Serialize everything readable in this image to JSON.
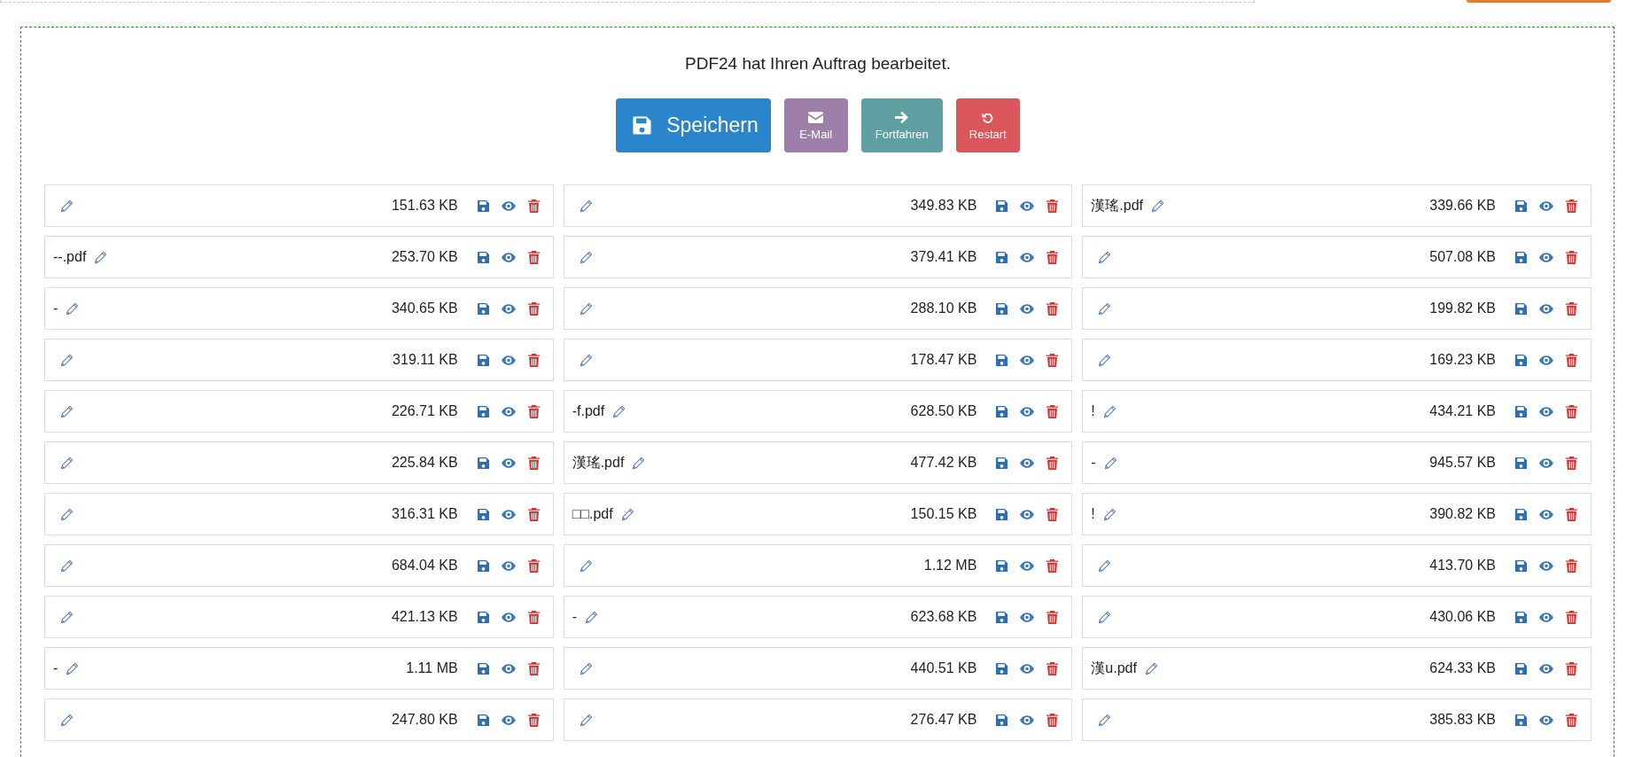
{
  "message": "PDF24 hat Ihren Auftrag bearbeitet.",
  "actions": [
    {
      "kind": "save",
      "label": "Speichern"
    },
    {
      "kind": "email",
      "label": "E-Mail"
    },
    {
      "kind": "continue",
      "label": "Fortfahren"
    },
    {
      "kind": "restart",
      "label": "Restart"
    }
  ],
  "files": [
    {
      "size": "151.63 KB"
    },
    {
      "size": "349.83 KB"
    },
    {
      "name": "漢瑤.pdf",
      "size": "339.66 KB"
    },
    {
      "name": "--.pdf",
      "size": "253.70 KB"
    },
    {
      "size": "379.41 KB"
    },
    {
      "size": "507.08 KB"
    },
    {
      "name": "-",
      "size": "340.65 KB"
    },
    {
      "size": "288.10 KB"
    },
    {
      "size": "199.82 KB"
    },
    {
      "size": "319.11 KB"
    },
    {
      "size": "178.47 KB"
    },
    {
      "size": "169.23 KB"
    },
    {
      "size": "226.71 KB"
    },
    {
      "name": "-f.pdf",
      "size": "628.50 KB"
    },
    {
      "name": "!",
      "size": "434.21 KB"
    },
    {
      "size": "225.84 KB"
    },
    {
      "name": "漢瑤.pdf",
      "size": "477.42 KB"
    },
    {
      "name": "-",
      "size": "945.57 KB"
    },
    {
      "size": "316.31 KB"
    },
    {
      "name": "□□.pdf",
      "size": "150.15 KB"
    },
    {
      "name": "!",
      "size": "390.82 KB"
    },
    {
      "size": "684.04 KB"
    },
    {
      "size": "1.12 MB"
    },
    {
      "size": "413.70 KB"
    },
    {
      "size": "421.13 KB"
    },
    {
      "name": "-",
      "size": "623.68 KB"
    },
    {
      "size": "430.06 KB"
    },
    {
      "name": "-",
      "size": "1.11 MB"
    },
    {
      "size": "440.51 KB"
    },
    {
      "name": "漢u.pdf",
      "size": "624.33 KB"
    },
    {
      "size": "247.80 KB"
    },
    {
      "size": "276.47 KB"
    },
    {
      "size": "385.83 KB"
    }
  ]
}
